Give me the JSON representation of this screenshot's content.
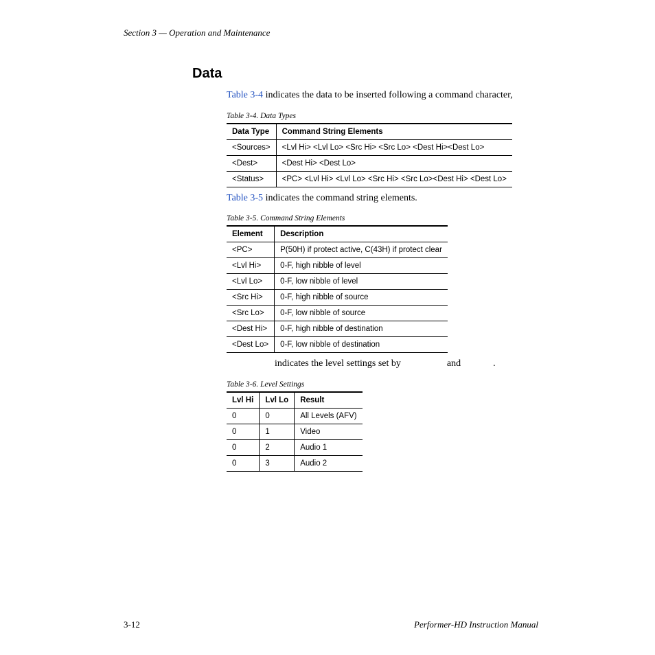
{
  "header": {
    "section": "Section 3 — Operation and Maintenance"
  },
  "title": "Data",
  "intro": {
    "linkText": "Table 3-4",
    "rest": " indicates the data to be inserted following a command character,"
  },
  "table34": {
    "caption": "Table 3-4.  Data Types",
    "headers": [
      "Data Type",
      "Command String Elements"
    ],
    "rows": [
      [
        "<Sources>",
        "<Lvl Hi> <Lvl Lo> <Src Hi> <Src Lo> <Dest Hi><Dest Lo>"
      ],
      [
        "<Dest>",
        "<Dest Hi> <Dest Lo>"
      ],
      [
        "<Status>",
        "<PC> <Lvl Hi> <Lvl Lo> <Src Hi> <Src Lo><Dest Hi> <Dest Lo>"
      ]
    ]
  },
  "mid": {
    "linkText": "Table 3-5",
    "rest": " indicates the command string elements."
  },
  "table35": {
    "caption": "Table 3-5.  Command String Elements",
    "headers": [
      "Element",
      "Description"
    ],
    "rows": [
      [
        "<PC>",
        "P(50H) if protect active, C(43H) if protect clear"
      ],
      [
        "<Lvl Hi>",
        "0-F, high nibble of level"
      ],
      [
        "<Lvl Lo>",
        "0-F, low nibble of level"
      ],
      [
        "<Src Hi>",
        "0-F, high nibble of source"
      ],
      [
        "<Src Lo>",
        "0-F, low nibble of source"
      ],
      [
        "<Dest Hi>",
        "0-F, high nibble of destination"
      ],
      [
        "<Dest Lo>",
        "0-F, low nibble of destination"
      ]
    ]
  },
  "levelText": {
    "part1": " indicates the level settings set by ",
    "part2": " and ",
    "part3": "."
  },
  "table36": {
    "caption": "Table 3-6.  Level Settings",
    "headers": [
      "Lvl Hi",
      "Lvl Lo",
      "Result"
    ],
    "rows": [
      [
        "0",
        "0",
        "All Levels (AFV)"
      ],
      [
        "0",
        "1",
        "Video"
      ],
      [
        "0",
        "2",
        "Audio 1"
      ],
      [
        "0",
        "3",
        "Audio 2"
      ]
    ]
  },
  "footer": {
    "page": "3-12",
    "doc": "Performer-HD Instruction Manual"
  }
}
